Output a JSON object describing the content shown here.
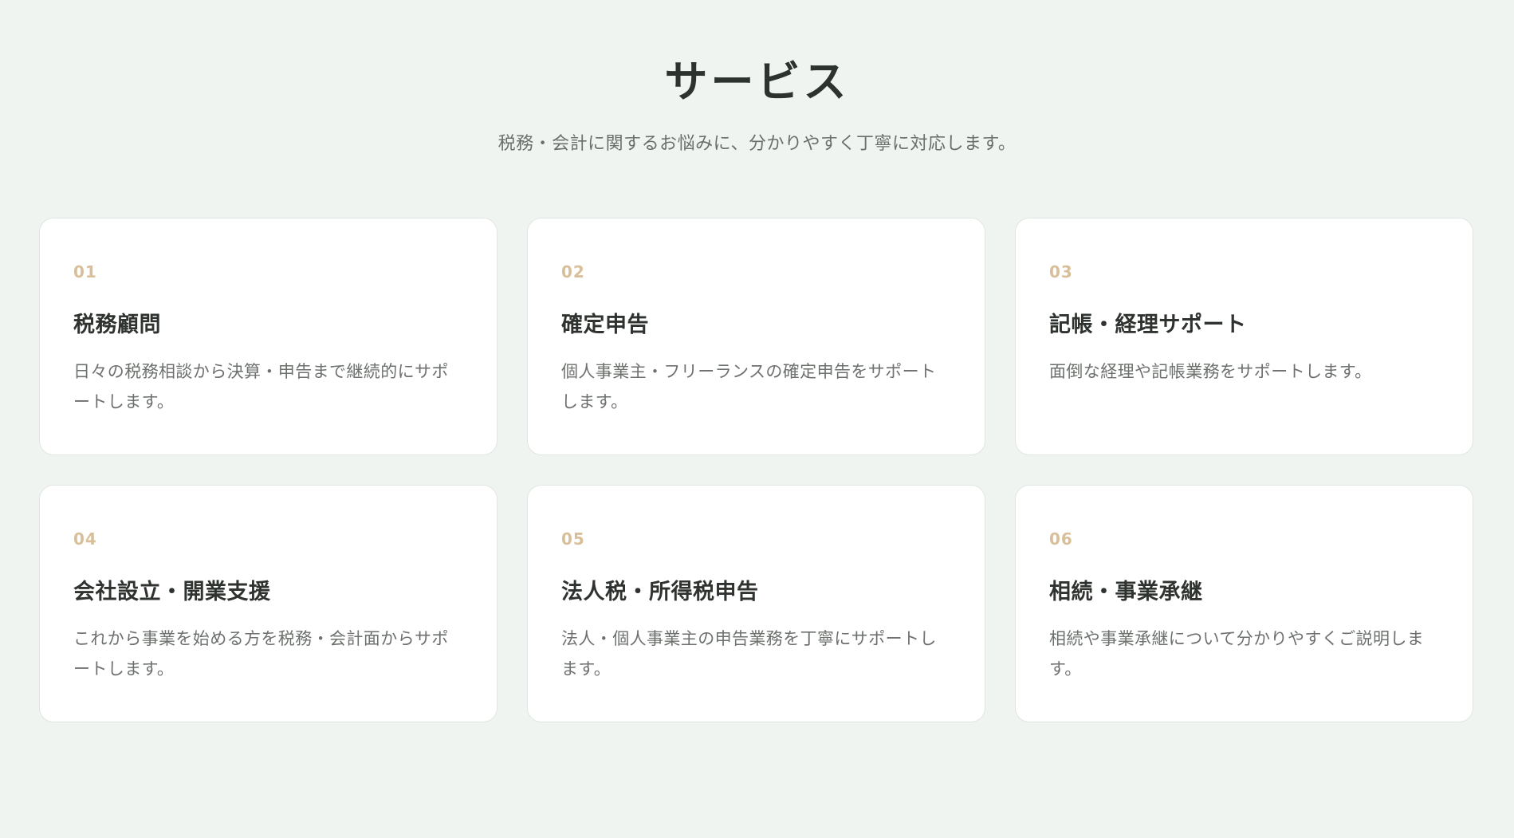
{
  "services": {
    "title": "サービス",
    "subtitle": "税務・会計に関するお悩みに、分かりやすく丁寧に対応します。",
    "cards": [
      {
        "number": "01",
        "title": "税務顧問",
        "description": "日々の税務相談から決算・申告まで継続的にサポートします。"
      },
      {
        "number": "02",
        "title": "確定申告",
        "description": "個人事業主・フリーランスの確定申告をサポートします。"
      },
      {
        "number": "03",
        "title": "記帳・経理サポート",
        "description": "面倒な経理や記帳業務をサポートします。"
      },
      {
        "number": "04",
        "title": "会社設立・開業支援",
        "description": "これから事業を始める方を税務・会計面からサポートします。"
      },
      {
        "number": "05",
        "title": "法人税・所得税申告",
        "description": "法人・個人事業主の申告業務を丁寧にサポートします。"
      },
      {
        "number": "06",
        "title": "相続・事業承継",
        "description": "相続や事業承継について分かりやすくご説明します。"
      }
    ]
  }
}
